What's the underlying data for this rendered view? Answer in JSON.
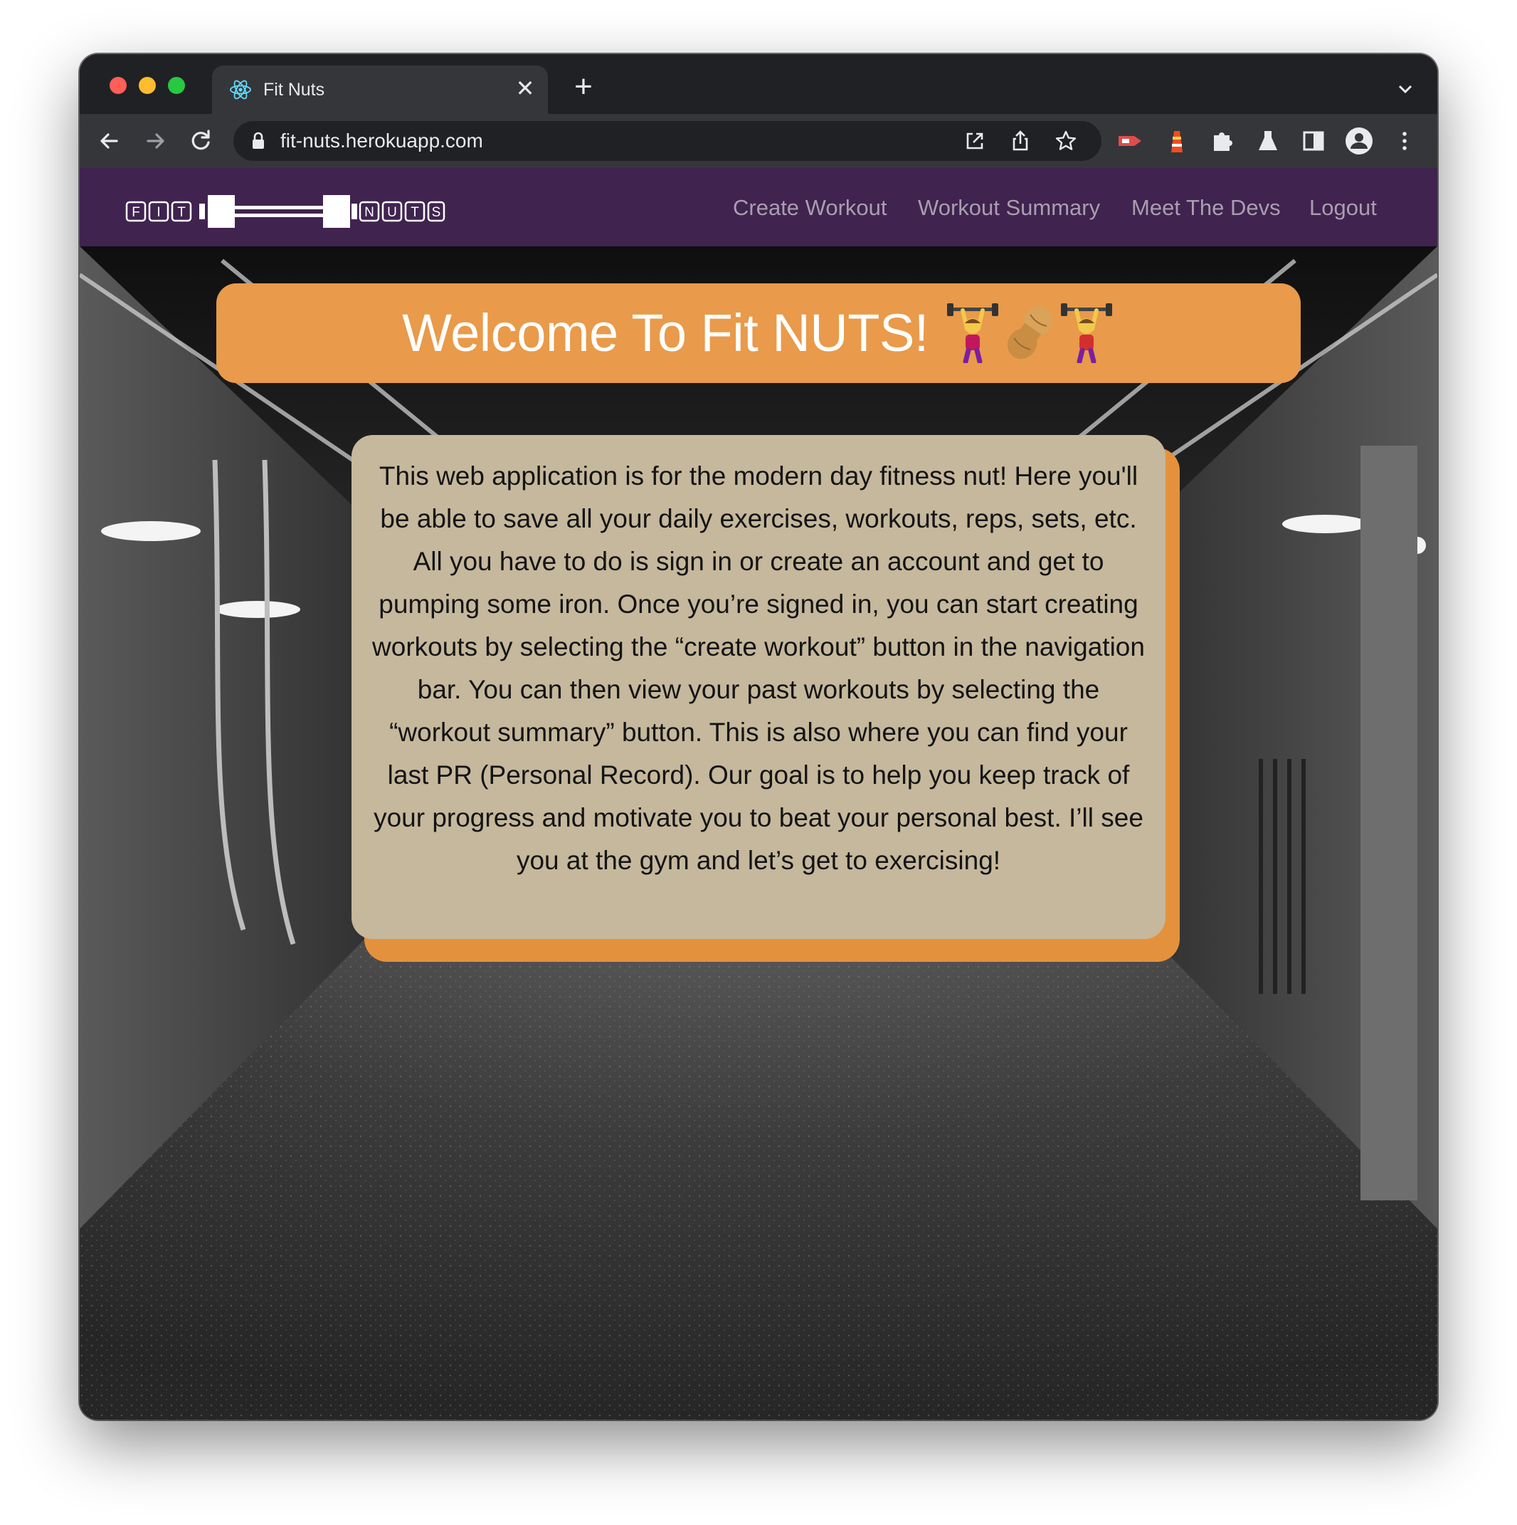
{
  "browser": {
    "tab_title": "Fit Nuts",
    "tab_favicon": "react-atom-icon",
    "url": "fit-nuts.herokuapp.com",
    "toolbar_icons": [
      "back-arrow-icon",
      "forward-arrow-icon",
      "reload-icon",
      "lock-icon",
      "open-in-app-icon",
      "share-icon",
      "star-icon"
    ],
    "extension_icons": [
      "red-tag-extension-icon",
      "lighthouse-icon",
      "puzzle-piece-icon",
      "flask-icon",
      "side-panel-icon",
      "profile-avatar-icon",
      "kebab-menu-icon"
    ]
  },
  "navbar": {
    "logo_left": [
      "F",
      "I",
      "T"
    ],
    "logo_right": [
      "N",
      "U",
      "T",
      "S"
    ],
    "links": [
      "Create Workout",
      "Workout Summary",
      "Meet The Devs",
      "Logout"
    ]
  },
  "main": {
    "welcome_title": "Welcome To Fit NUTS!",
    "welcome_emojis": [
      "woman-lifting-weights-icon",
      "peanut-icon",
      "woman-lifting-weights-icon"
    ],
    "description": "This web application is for the modern day fitness nut! Here you'll be able to save all your daily exercises, workouts, reps, sets, etc. All you have to do is sign in or create an account and get to pumping some iron. Once you’re signed in, you can start creating workouts by selecting the “create workout” button in the navigation bar. You can then view your past workouts by selecting the “workout summary” button. This is also where you can find your last PR (Personal Record). Our goal is to help you keep track of your progress and motivate you to beat your personal best. I’ll see you at the gym and let’s get to exercising!"
  },
  "colors": {
    "navbar_bg": "#40234f",
    "nav_link": "#a99eb0",
    "banner_bg": "#e99a4a",
    "card_bg": "#c6b89c",
    "card_shadow": "#e4913d"
  }
}
